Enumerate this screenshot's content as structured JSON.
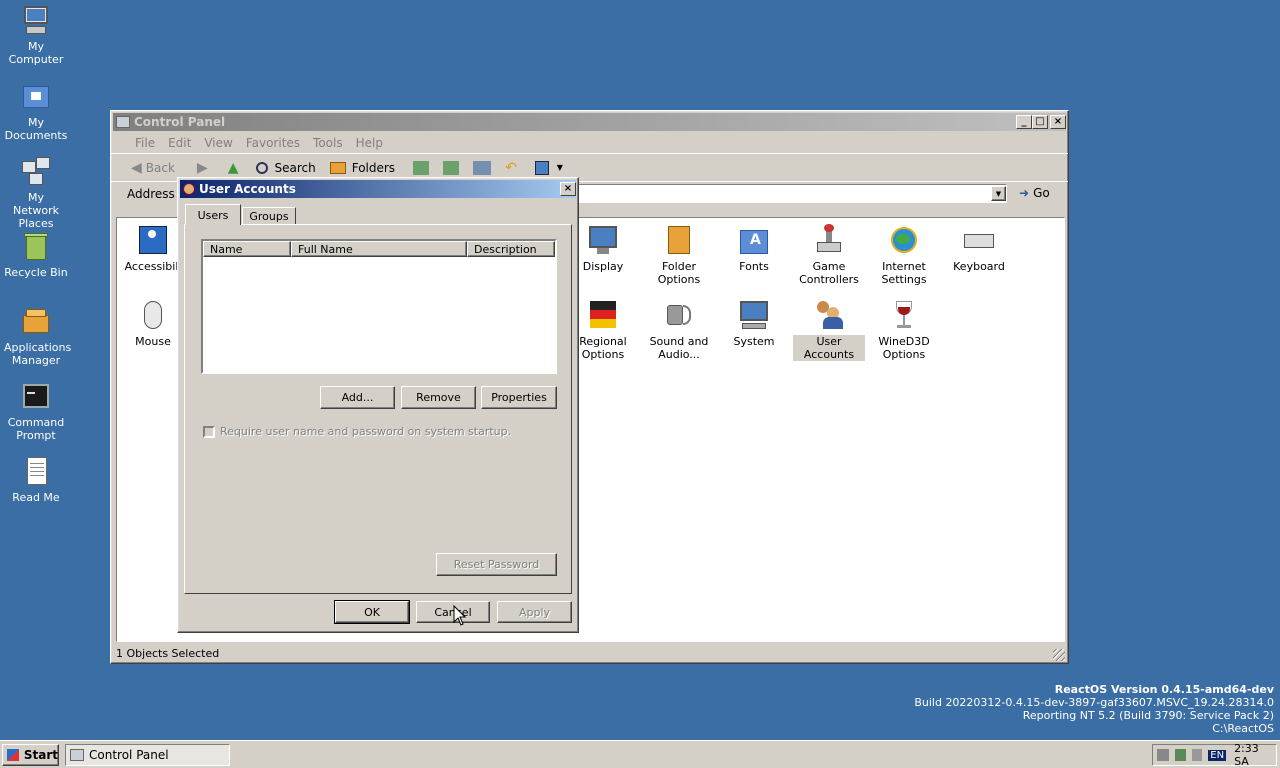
{
  "desktop": {
    "icons": [
      {
        "label": "My Computer",
        "icon": "computer-icon"
      },
      {
        "label": "My Documents",
        "icon": "folder-icon"
      },
      {
        "label": "My Network Places",
        "icon": "network-icon"
      },
      {
        "label": "Recycle Bin",
        "icon": "recycle-bin-icon"
      },
      {
        "label": "Applications Manager",
        "icon": "app-manager-icon"
      },
      {
        "label": "Command Prompt",
        "icon": "command-prompt-icon"
      },
      {
        "label": "Read Me",
        "icon": "document-icon"
      }
    ],
    "version": {
      "line1": "ReactOS Version 0.4.15-amd64-dev",
      "line2": "Build 20220312-0.4.15-dev-3897-gaf33607.MSVC_19.24.28314.0",
      "line3": "Reporting NT 5.2 (Build 3790: Service Pack 2)",
      "line4": "C:\\ReactOS"
    }
  },
  "control_panel": {
    "title": "Control Panel",
    "menu": [
      "File",
      "Edit",
      "View",
      "Favorites",
      "Tools",
      "Help"
    ],
    "toolbar": {
      "back": "Back",
      "search": "Search",
      "folders": "Folders"
    },
    "address_label": "Address",
    "go_label": "Go",
    "status": "1 Objects Selected",
    "items": [
      {
        "label": "Accessibili",
        "icon": "accessibility-icon"
      },
      {
        "label": "Mouse",
        "icon": "mouse-icon"
      },
      {
        "label": "Display",
        "icon": "display-icon"
      },
      {
        "label": "Folder Options",
        "icon": "folder-options-icon"
      },
      {
        "label": "Fonts",
        "icon": "fonts-icon"
      },
      {
        "label": "Game Controllers",
        "icon": "game-controller-icon"
      },
      {
        "label": "Internet Settings",
        "icon": "internet-icon"
      },
      {
        "label": "Keyboard",
        "icon": "keyboard-icon"
      },
      {
        "label": "Regional Options",
        "icon": "regional-icon"
      },
      {
        "label": "Sound and Audio...",
        "icon": "sound-icon"
      },
      {
        "label": "System",
        "icon": "system-icon"
      },
      {
        "label": "User Accounts",
        "icon": "user-accounts-icon"
      },
      {
        "label": "WineD3D Options",
        "icon": "wined3d-icon"
      }
    ]
  },
  "dialog": {
    "title": "User Accounts",
    "tabs": [
      "Users",
      "Groups"
    ],
    "columns": [
      "Name",
      "Full Name",
      "Description"
    ],
    "add": "Add...",
    "remove": "Remove",
    "properties": "Properties",
    "checkbox": "Require user name and password on system startup.",
    "reset": "Reset Password",
    "ok": "OK",
    "cancel": "Cancel",
    "apply": "Apply"
  },
  "taskbar": {
    "start": "Start",
    "task": "Control Panel",
    "lang": "EN",
    "clock": "2:33 SA"
  }
}
